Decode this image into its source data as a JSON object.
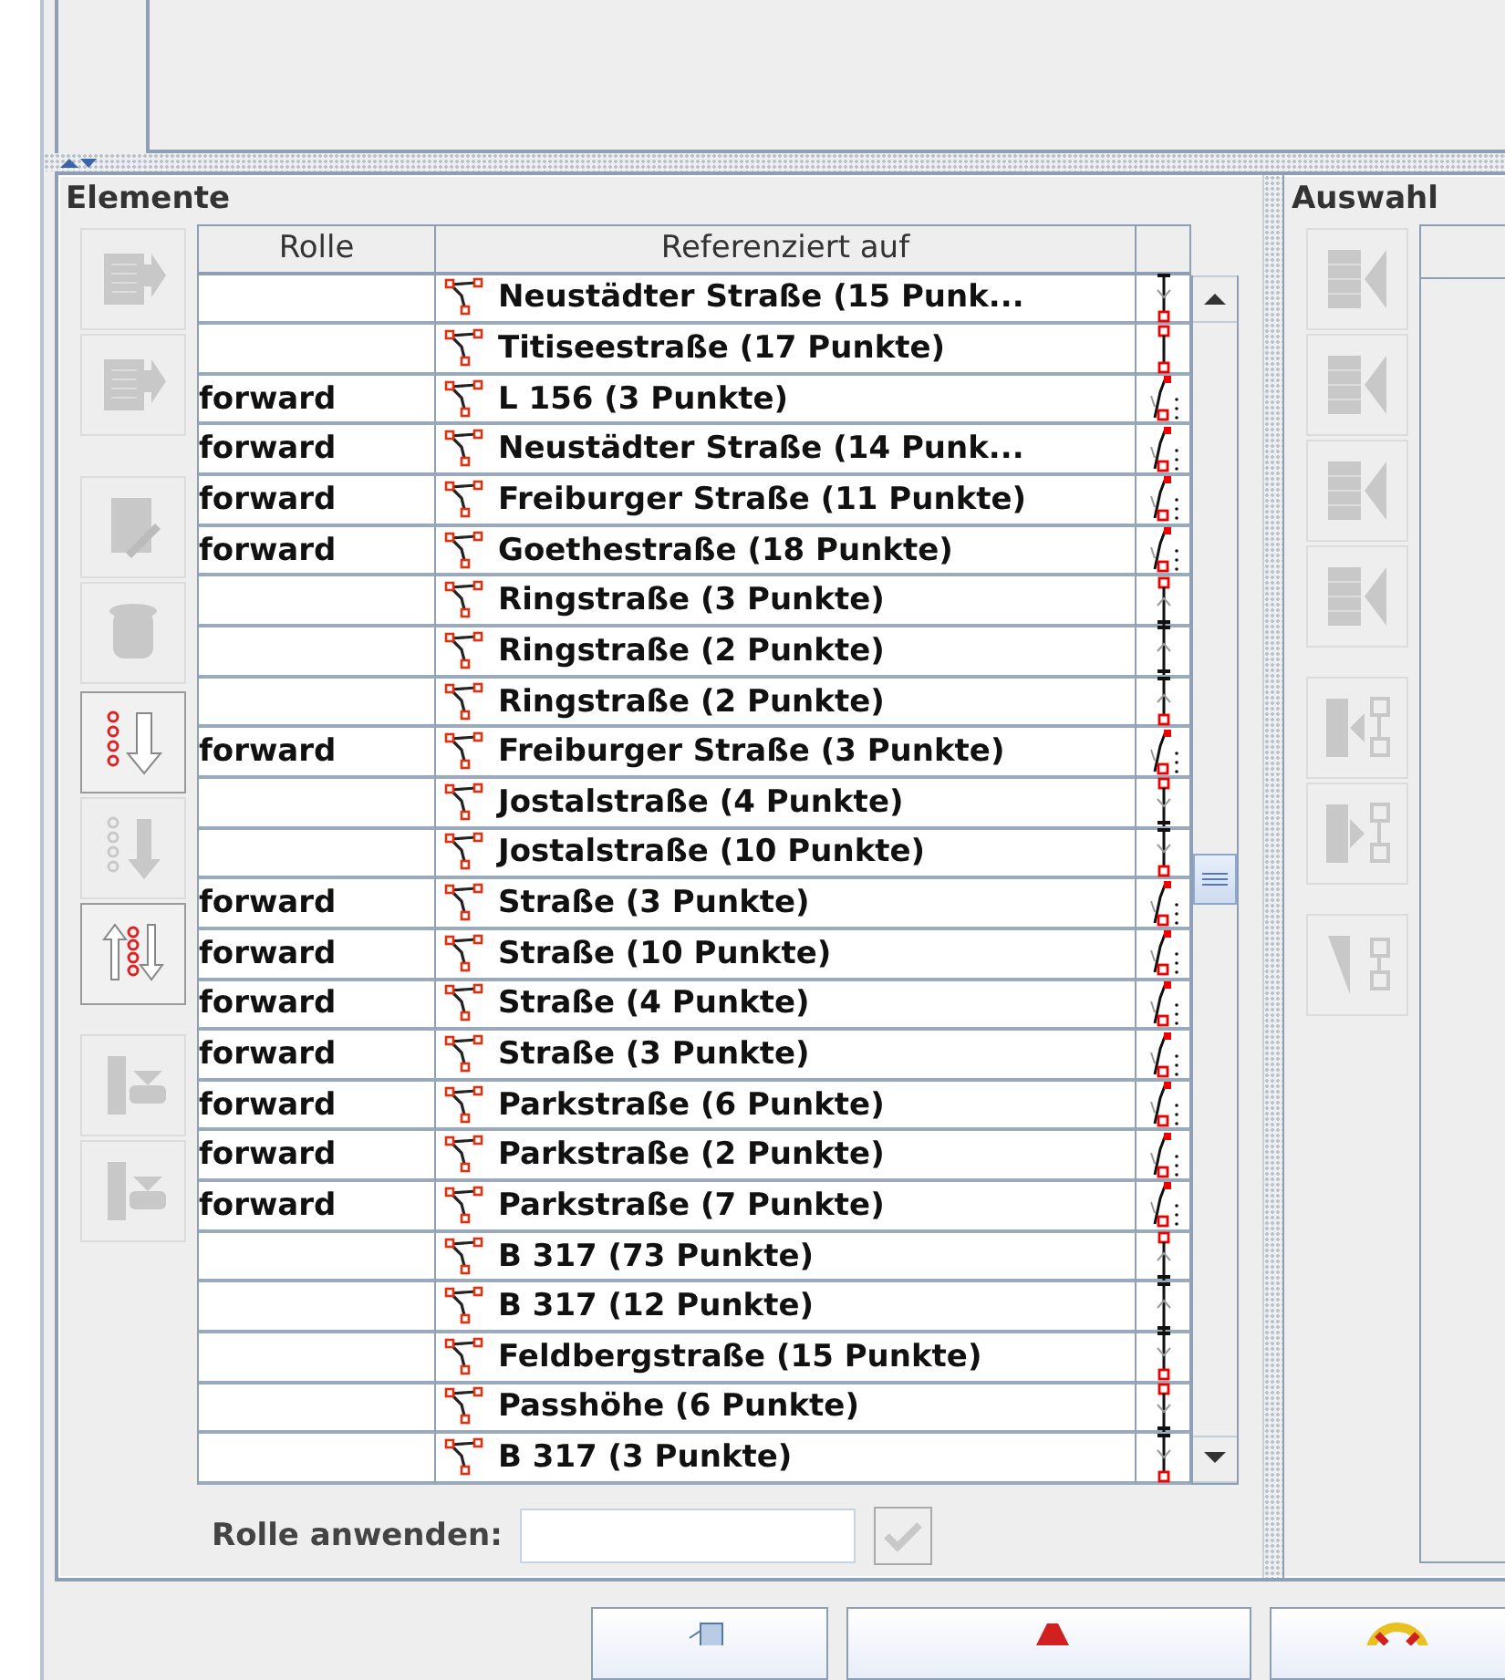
{
  "elements_panel": {
    "title": "Elemente",
    "toolbar": [
      {
        "kind": "move-up",
        "disabled": true
      },
      {
        "kind": "move-down",
        "disabled": true
      },
      {
        "kind": "edit",
        "disabled": true
      },
      {
        "kind": "delete",
        "disabled": true
      },
      {
        "kind": "sort",
        "disabled": false
      },
      {
        "kind": "sort-below",
        "disabled": true
      },
      {
        "kind": "reverse",
        "disabled": false
      },
      {
        "kind": "download",
        "disabled": true
      },
      {
        "kind": "download-selected",
        "disabled": true
      }
    ],
    "table": {
      "columns": [
        "Rolle",
        "Referenziert auf"
      ],
      "rows": [
        {
          "role": "",
          "member": "Neustädter Straße (15 Punk...",
          "link": {
            "kind": "down-end"
          }
        },
        {
          "role": "",
          "member": "Titiseestraße (17 Punkte)",
          "link": {
            "kind": "single"
          }
        },
        {
          "role": "forward",
          "member": "L 156 (3 Punkte)",
          "link": {
            "kind": "oneway"
          }
        },
        {
          "role": "forward",
          "member": "Neustädter Straße (14 Punk...",
          "link": {
            "kind": "oneway"
          }
        },
        {
          "role": "forward",
          "member": "Freiburger Straße (11 Punkte)",
          "link": {
            "kind": "oneway"
          }
        },
        {
          "role": "forward",
          "member": "Goethestraße (18 Punkte)",
          "link": {
            "kind": "oneway"
          }
        },
        {
          "role": "",
          "member": "Ringstraße (3 Punkte)",
          "link": {
            "kind": "up-start"
          }
        },
        {
          "role": "",
          "member": "Ringstraße (2 Punkte)",
          "link": {
            "kind": "up-mid"
          }
        },
        {
          "role": "",
          "member": "Ringstraße (2 Punkte)",
          "link": {
            "kind": "up-end"
          }
        },
        {
          "role": "forward",
          "member": "Freiburger Straße (3 Punkte)",
          "link": {
            "kind": "oneway"
          }
        },
        {
          "role": "",
          "member": "Jostalstraße (4 Punkte)",
          "link": {
            "kind": "down-start"
          }
        },
        {
          "role": "",
          "member": "Jostalstraße (10 Punkte)",
          "link": {
            "kind": "down-end"
          }
        },
        {
          "role": "forward",
          "member": "Straße (3 Punkte)",
          "link": {
            "kind": "oneway"
          }
        },
        {
          "role": "forward",
          "member": "Straße (10 Punkte)",
          "link": {
            "kind": "oneway"
          }
        },
        {
          "role": "forward",
          "member": "Straße (4 Punkte)",
          "link": {
            "kind": "oneway"
          }
        },
        {
          "role": "forward",
          "member": "Straße (3 Punkte)",
          "link": {
            "kind": "oneway"
          }
        },
        {
          "role": "forward",
          "member": "Parkstraße (6 Punkte)",
          "link": {
            "kind": "oneway"
          }
        },
        {
          "role": "forward",
          "member": "Parkstraße (2 Punkte)",
          "link": {
            "kind": "oneway"
          }
        },
        {
          "role": "forward",
          "member": "Parkstraße (7 Punkte)",
          "link": {
            "kind": "oneway"
          }
        },
        {
          "role": "",
          "member": "B 317 (73 Punkte)",
          "link": {
            "kind": "up-start"
          }
        },
        {
          "role": "",
          "member": "B 317 (12 Punkte)",
          "link": {
            "kind": "up-mid"
          }
        },
        {
          "role": "",
          "member": "Feldbergstraße (15 Punkte)",
          "link": {
            "kind": "down-end"
          }
        },
        {
          "role": "",
          "member": "Passhöhe (6 Punkte)",
          "link": {
            "kind": "down-start"
          }
        },
        {
          "role": "",
          "member": "B 317 (3 Punkte)",
          "link": {
            "kind": "down-end"
          }
        }
      ]
    },
    "apply_role": {
      "label": "Rolle anwenden:",
      "apply_disabled": true
    }
  },
  "selection_panel": {
    "title": "Auswahl",
    "toolbar": [
      {
        "kind": "add-top",
        "disabled": true
      },
      {
        "kind": "add-top",
        "disabled": true
      },
      {
        "kind": "add-top",
        "disabled": true
      },
      {
        "kind": "add-top",
        "disabled": true
      },
      {
        "kind": "add-before",
        "disabled": true
      },
      {
        "kind": "add-after",
        "disabled": true
      },
      {
        "kind": "select",
        "disabled": true
      }
    ]
  },
  "bottom_buttons": [
    {
      "kind": "ok"
    },
    {
      "kind": "cancel"
    },
    {
      "kind": "help"
    }
  ]
}
